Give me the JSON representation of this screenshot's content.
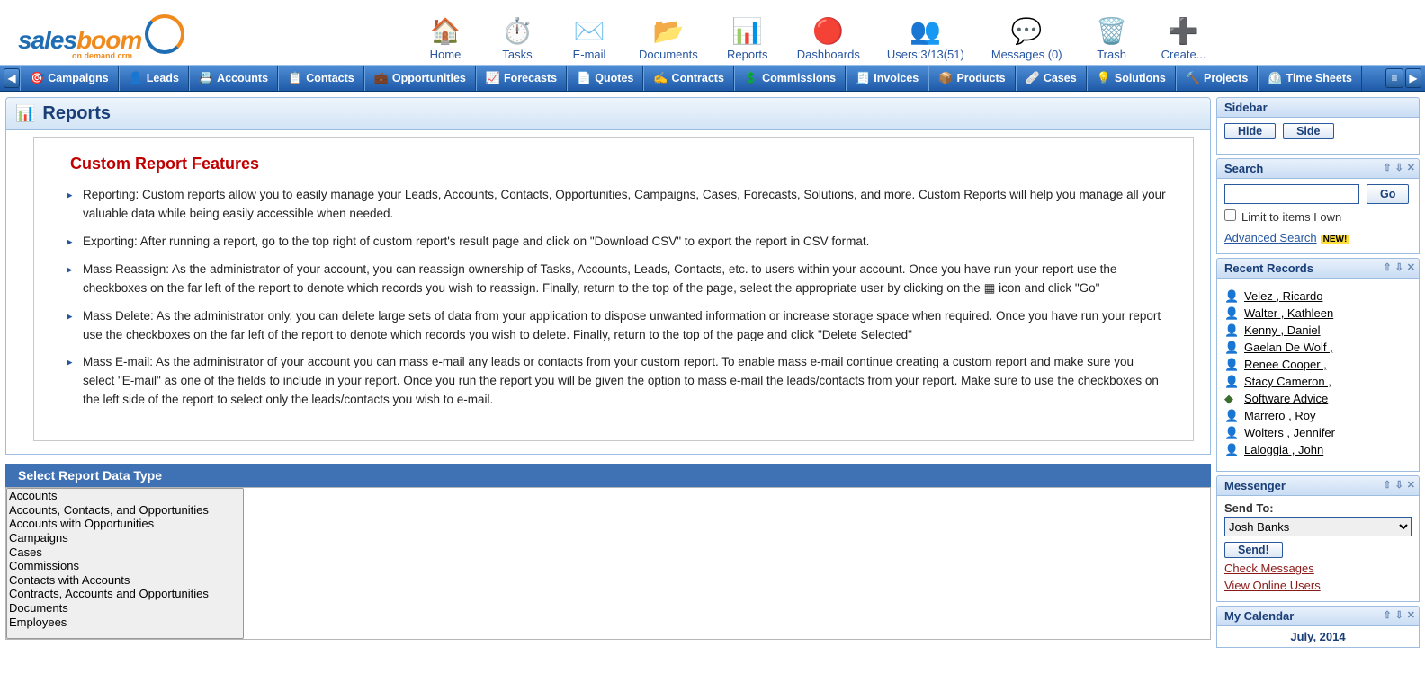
{
  "logo": {
    "text1": "sales",
    "text2": "boom",
    "sub": "on demand crm"
  },
  "topIcons": [
    {
      "glyph": "🏠",
      "label": "Home"
    },
    {
      "glyph": "⏱️",
      "label": "Tasks"
    },
    {
      "glyph": "✉️",
      "label": "E-mail"
    },
    {
      "glyph": "📂",
      "label": "Documents"
    },
    {
      "glyph": "📊",
      "label": "Reports"
    },
    {
      "glyph": "🔴",
      "label": "Dashboards"
    },
    {
      "glyph": "👥",
      "label": "Users:3/13(51)"
    },
    {
      "glyph": "💬",
      "label": "Messages (0)"
    },
    {
      "glyph": "🗑️",
      "label": "Trash"
    },
    {
      "glyph": "➕",
      "label": "Create..."
    }
  ],
  "nav": [
    {
      "icon": "🎯",
      "label": "Campaigns"
    },
    {
      "icon": "👤",
      "label": "Leads"
    },
    {
      "icon": "📇",
      "label": "Accounts"
    },
    {
      "icon": "📋",
      "label": "Contacts"
    },
    {
      "icon": "💼",
      "label": "Opportunities"
    },
    {
      "icon": "📈",
      "label": "Forecasts"
    },
    {
      "icon": "📄",
      "label": "Quotes"
    },
    {
      "icon": "✍️",
      "label": "Contracts"
    },
    {
      "icon": "💲",
      "label": "Commissions"
    },
    {
      "icon": "🧾",
      "label": "Invoices"
    },
    {
      "icon": "📦",
      "label": "Products"
    },
    {
      "icon": "🩹",
      "label": "Cases"
    },
    {
      "icon": "💡",
      "label": "Solutions"
    },
    {
      "icon": "🔨",
      "label": "Projects"
    },
    {
      "icon": "⏲️",
      "label": "Time Sheets"
    }
  ],
  "reports": {
    "title": "Reports",
    "featuresHeading": "Custom Report Features",
    "features": [
      "Reporting: Custom reports allow you to easily manage your Leads, Accounts, Contacts, Opportunities, Campaigns, Cases, Forecasts, Solutions, and more. Custom Reports will help you manage all your valuable data while being easily accessible when needed.",
      "Exporting: After running a report, go to the top right of custom report's result page and click on \"Download CSV\" to export the report in CSV format.",
      "Mass Reassign: As the administrator of your account, you can reassign ownership of Tasks, Accounts, Leads, Contacts, etc. to users within your account. Once you have run your report use the checkboxes on the far left of the report to denote which records you wish to reassign. Finally, return to the top of the page, select the appropriate user by clicking on the ▦ icon and click \"Go\"",
      "Mass Delete: As the administrator only, you can delete large sets of data from your application to dispose unwanted information or increase storage space when required. Once you have run your report use the checkboxes on the far left of the report to denote which records you wish to delete. Finally, return to the top of the page and click \"Delete Selected\"",
      "Mass E-mail: As the administrator of your account you can mass e-mail any leads or contacts from your custom report. To enable mass e-mail continue creating a custom report and make sure you select \"E-mail\" as one of the fields to include in your report. Once you run the report you will be given the option to mass e-mail the leads/contacts from your report. Make sure to use the checkboxes on the left side of the report to select only the leads/contacts you wish to e-mail."
    ],
    "selectHeader": "Select Report Data Type",
    "dataTypes": [
      "Accounts",
      "Accounts, Contacts, and Opportunities",
      "Accounts with Opportunities",
      "Campaigns",
      "Cases",
      "Commissions",
      "Contacts with Accounts",
      "Contracts, Accounts and Opportunities",
      "Documents",
      "Employees"
    ]
  },
  "sidebar": {
    "title": "Sidebar",
    "hide": "Hide",
    "side": "Side",
    "search": {
      "title": "Search",
      "go": "Go",
      "limit": "Limit to items I own",
      "advanced": "Advanced Search",
      "new": "NEW!"
    },
    "recent": {
      "title": "Recent Records",
      "items": [
        {
          "label": "Velez , Ricardo",
          "type": "user"
        },
        {
          "label": "Walter , Kathleen",
          "type": "user"
        },
        {
          "label": "Kenny , Daniel",
          "type": "user"
        },
        {
          "label": "Gaelan De Wolf ,",
          "type": "user"
        },
        {
          "label": "Renee Cooper ,",
          "type": "user"
        },
        {
          "label": "Stacy Cameron ,",
          "type": "user"
        },
        {
          "label": "Software Advice",
          "type": "software"
        },
        {
          "label": "Marrero , Roy",
          "type": "user"
        },
        {
          "label": "Wolters , Jennifer",
          "type": "user"
        },
        {
          "label": "Laloggia , John",
          "type": "user"
        }
      ]
    },
    "messenger": {
      "title": "Messenger",
      "sendTo": "Send To:",
      "selected": "Josh Banks",
      "send": "Send!",
      "check": "Check Messages",
      "view": "View Online Users"
    },
    "calendar": {
      "title": "My Calendar",
      "month": "July, 2014"
    }
  }
}
